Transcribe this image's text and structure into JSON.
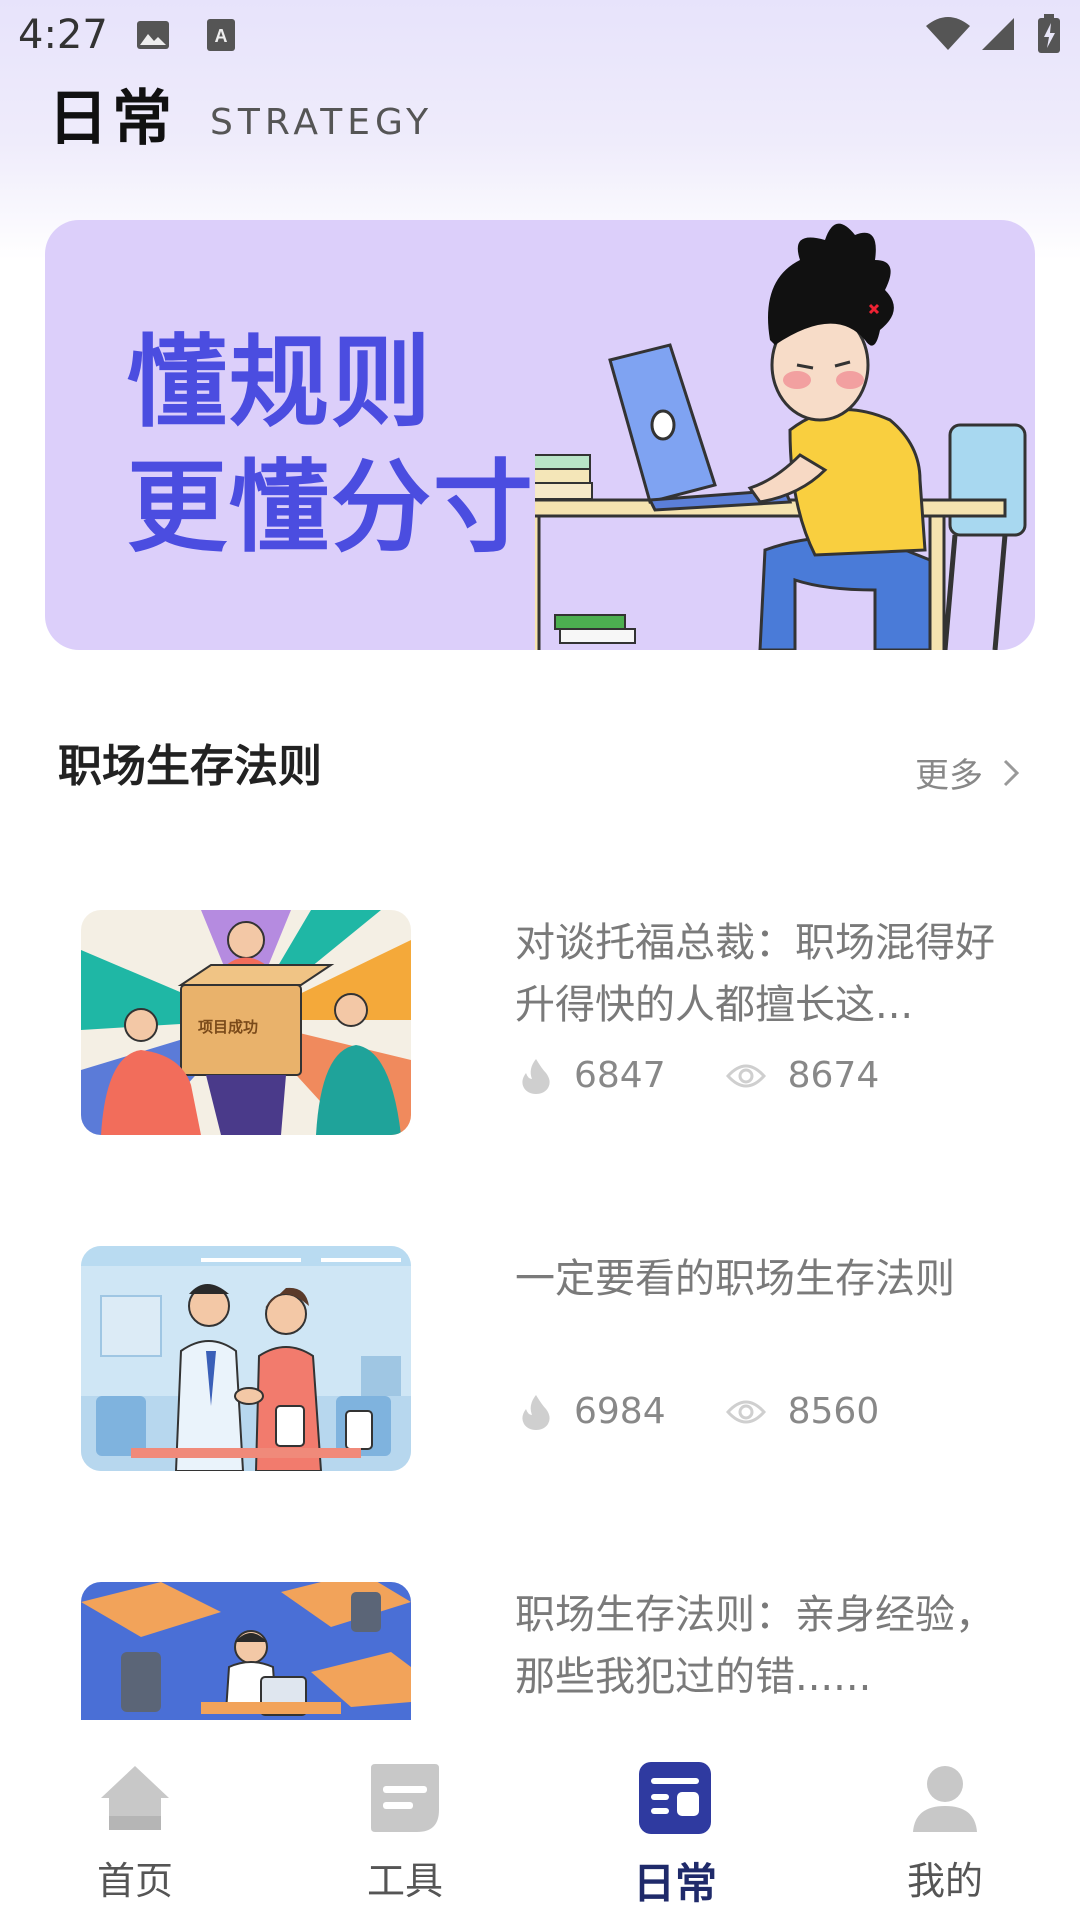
{
  "status_bar": {
    "time": "4:27"
  },
  "header": {
    "title": "日常",
    "subtitle": "STRATEGY"
  },
  "banner": {
    "line1": "懂规则",
    "line2": "更懂分寸"
  },
  "section": {
    "title": "职场生存法则",
    "more_label": "更多"
  },
  "articles": [
    {
      "title": "对谈托福总裁：职场混得好升得快的人都擅长这...",
      "likes": "6847",
      "views": "8674",
      "thumb_text": "项目成功"
    },
    {
      "title": "一定要看的职场生存法则",
      "likes": "6984",
      "views": "8560"
    },
    {
      "title": "职场生存法则：亲身经验，那些我犯过的错......",
      "likes": "",
      "views": ""
    }
  ],
  "nav": {
    "items": [
      {
        "label": "首页",
        "icon": "home-icon"
      },
      {
        "label": "工具",
        "icon": "tools-icon"
      },
      {
        "label": "日常",
        "icon": "daily-icon",
        "active": true
      },
      {
        "label": "我的",
        "icon": "profile-icon"
      }
    ]
  },
  "colors": {
    "accent": "#2f3aa0",
    "banner_bg": "#dccffa",
    "banner_text": "#4b4de0"
  }
}
